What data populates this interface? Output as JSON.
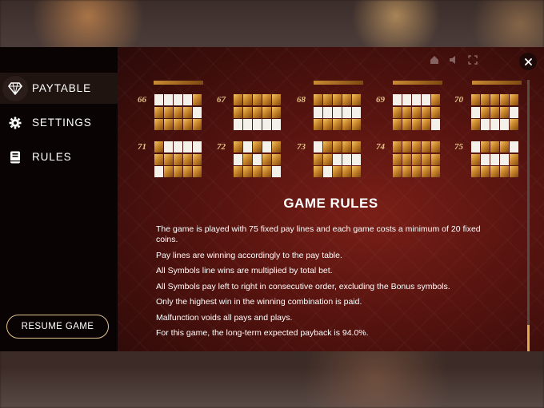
{
  "sidebar": {
    "items": [
      {
        "label": "PAYTABLE",
        "icon": "diamond-icon",
        "active": true
      },
      {
        "label": "SETTINGS",
        "icon": "gear-icon",
        "active": false
      },
      {
        "label": "RULES",
        "icon": "book-icon",
        "active": false
      }
    ],
    "resume_label": "RESUME GAME"
  },
  "paylines": [
    {
      "number": "66",
      "pattern": [
        [
          1,
          1,
          1,
          1,
          0
        ],
        [
          0,
          0,
          0,
          0,
          1
        ],
        [
          0,
          0,
          0,
          0,
          0
        ]
      ]
    },
    {
      "number": "67",
      "pattern": [
        [
          0,
          0,
          0,
          0,
          0
        ],
        [
          0,
          0,
          0,
          0,
          0
        ],
        [
          1,
          1,
          1,
          1,
          1
        ]
      ]
    },
    {
      "number": "68",
      "pattern": [
        [
          0,
          0,
          0,
          0,
          0
        ],
        [
          1,
          1,
          1,
          1,
          1
        ],
        [
          0,
          0,
          0,
          0,
          0
        ]
      ]
    },
    {
      "number": "69",
      "pattern": [
        [
          1,
          1,
          1,
          1,
          0
        ],
        [
          0,
          0,
          0,
          0,
          0
        ],
        [
          0,
          0,
          0,
          0,
          1
        ]
      ]
    },
    {
      "number": "70",
      "pattern": [
        [
          0,
          0,
          0,
          0,
          0
        ],
        [
          1,
          0,
          0,
          0,
          1
        ],
        [
          0,
          1,
          1,
          1,
          0
        ]
      ]
    },
    {
      "number": "71",
      "pattern": [
        [
          0,
          1,
          1,
          1,
          1
        ],
        [
          0,
          0,
          0,
          0,
          0
        ],
        [
          1,
          0,
          0,
          0,
          0
        ]
      ]
    },
    {
      "number": "72",
      "pattern": [
        [
          0,
          1,
          0,
          1,
          0
        ],
        [
          1,
          0,
          1,
          0,
          0
        ],
        [
          0,
          0,
          0,
          0,
          1
        ]
      ]
    },
    {
      "number": "73",
      "pattern": [
        [
          1,
          0,
          0,
          0,
          0
        ],
        [
          0,
          0,
          1,
          1,
          1
        ],
        [
          0,
          1,
          0,
          0,
          0
        ]
      ]
    },
    {
      "number": "74",
      "pattern": [
        [
          0,
          0,
          0,
          0,
          0
        ],
        [
          0,
          0,
          0,
          0,
          0
        ],
        [
          0,
          0,
          0,
          0,
          0
        ]
      ]
    },
    {
      "number": "75",
      "pattern": [
        [
          1,
          0,
          0,
          0,
          1
        ],
        [
          0,
          1,
          1,
          1,
          0
        ],
        [
          0,
          0,
          0,
          0,
          0
        ]
      ]
    }
  ],
  "rules": {
    "title": "GAME RULES",
    "lines": [
      "The game is played with 75 fixed pay lines and each game costs a minimum of 20 fixed coins.",
      "Pay lines are winning accordingly to the pay table.",
      "All Symbols line wins are multiplied by total bet.",
      "All Symbols pay left to right in consecutive order, excluding the Bonus symbols.",
      "Only the highest win in the winning combination is paid.",
      "Malfunction voids all pays and plays.",
      "For this game, the long-term expected payback is 94.0%."
    ]
  },
  "colors": {
    "accent": "#e0ac4a",
    "panel": "#0a0303",
    "content_bg": "#56130f"
  }
}
